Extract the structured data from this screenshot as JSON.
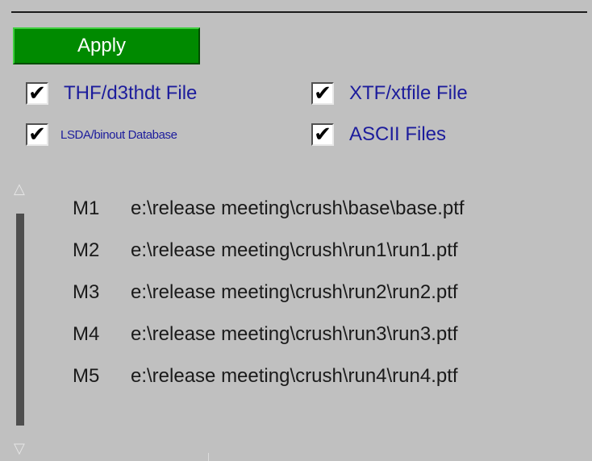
{
  "apply_button": {
    "label": "Apply"
  },
  "checkboxes": [
    {
      "label": "THF/d3thdt File",
      "checked": true,
      "mark": "✔"
    },
    {
      "label": "XTF/xtfile File",
      "checked": true,
      "mark": "✔"
    },
    {
      "label": "LSDA/binout Database",
      "checked": true,
      "mark": "✔"
    },
    {
      "label": "ASCII Files",
      "checked": true,
      "mark": "✔"
    }
  ],
  "scrollbar": {
    "up_arrow": "△",
    "down_arrow": "▽"
  },
  "models": [
    {
      "id": "M1",
      "path": "e:\\release meeting\\crush\\base\\base.ptf"
    },
    {
      "id": "M2",
      "path": "e:\\release meeting\\crush\\run1\\run1.ptf"
    },
    {
      "id": "M3",
      "path": "e:\\release meeting\\crush\\run2\\run2.ptf"
    },
    {
      "id": "M4",
      "path": "e:\\release meeting\\crush\\run3\\run3.ptf"
    },
    {
      "id": "M5",
      "path": "e:\\release meeting\\crush\\run4\\run4.ptf"
    }
  ],
  "colors": {
    "panel_background": "#c0c0c0",
    "apply_button": "#008a00",
    "checkbox_label": "#1c1c9c",
    "list_text": "#1a1a1a",
    "scroll_thumb": "#4e4e4e"
  }
}
